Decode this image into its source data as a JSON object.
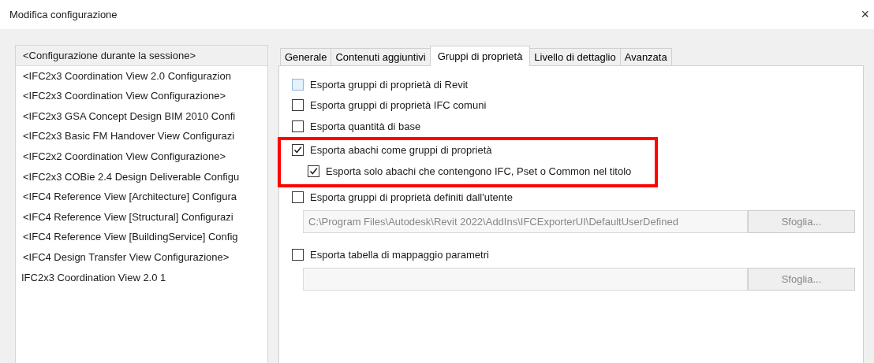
{
  "window": {
    "title": "Modifica configurazione",
    "close": "×"
  },
  "configurations": [
    {
      "label": "<Configurazione durante la sessione>",
      "selected": true
    },
    {
      "label": "<IFC2x3 Coordination View 2.0 Configurazion",
      "selected": false
    },
    {
      "label": "<IFC2x3 Coordination View Configurazione>",
      "selected": false
    },
    {
      "label": "<IFC2x3 GSA Concept Design BIM 2010 Confi",
      "selected": false
    },
    {
      "label": "<IFC2x3 Basic FM Handover View Configurazi",
      "selected": false
    },
    {
      "label": "<IFC2x2 Coordination View Configurazione>",
      "selected": false
    },
    {
      "label": "<IFC2x3 COBie 2.4 Design Deliverable Configu",
      "selected": false
    },
    {
      "label": "<IFC4 Reference View [Architecture] Configura",
      "selected": false
    },
    {
      "label": "<IFC4 Reference View [Structural] Configurazi",
      "selected": false
    },
    {
      "label": "<IFC4 Reference View [BuildingService] Config",
      "selected": false
    },
    {
      "label": "<IFC4 Design Transfer View Configurazione>",
      "selected": false
    },
    {
      "label": "IFC2x3 Coordination View 2.0 1",
      "selected": false
    }
  ],
  "tabs": [
    {
      "label": "Generale",
      "selected": false
    },
    {
      "label": "Contenuti aggiuntivi",
      "selected": false
    },
    {
      "label": "Gruppi di proprietà",
      "selected": true
    },
    {
      "label": "Livello di dettaglio",
      "selected": false
    },
    {
      "label": "Avanzata",
      "selected": false
    }
  ],
  "options": [
    {
      "kind": "checkbox",
      "label": "Esporta gruppi di proprietà di Revit",
      "checked": false,
      "hovered": true,
      "highlighted": false
    },
    {
      "kind": "checkbox",
      "label": "Esporta gruppi di proprietà IFC comuni",
      "checked": false,
      "hovered": false,
      "highlighted": false
    },
    {
      "kind": "checkbox",
      "label": "Esporta quantità di base",
      "checked": false,
      "hovered": false,
      "highlighted": false
    },
    {
      "kind": "checkbox",
      "label": "Esporta abachi come gruppi di proprietà",
      "checked": true,
      "hovered": false,
      "highlighted": true,
      "children": [
        {
          "kind": "checkbox",
          "label": "Esporta solo abachi che contengono IFC, Pset o Common nel titolo",
          "checked": true,
          "hovered": false,
          "highlighted": false
        }
      ]
    },
    {
      "kind": "checkbox",
      "label": "Esporta gruppi di proprietà definiti dall'utente",
      "checked": false,
      "hovered": false,
      "highlighted": false
    },
    {
      "kind": "file",
      "value": "C:\\Program Files\\Autodesk\\Revit 2022\\AddIns\\IFCExporterUI\\DefaultUserDefined",
      "button": "Sfoglia...",
      "disabled": true
    },
    {
      "kind": "checkbox",
      "label": "Esporta tabella di mappaggio parametri",
      "checked": false,
      "hovered": false,
      "highlighted": false
    },
    {
      "kind": "file",
      "button": "Sfoglia...",
      "disabled": true
    }
  ]
}
